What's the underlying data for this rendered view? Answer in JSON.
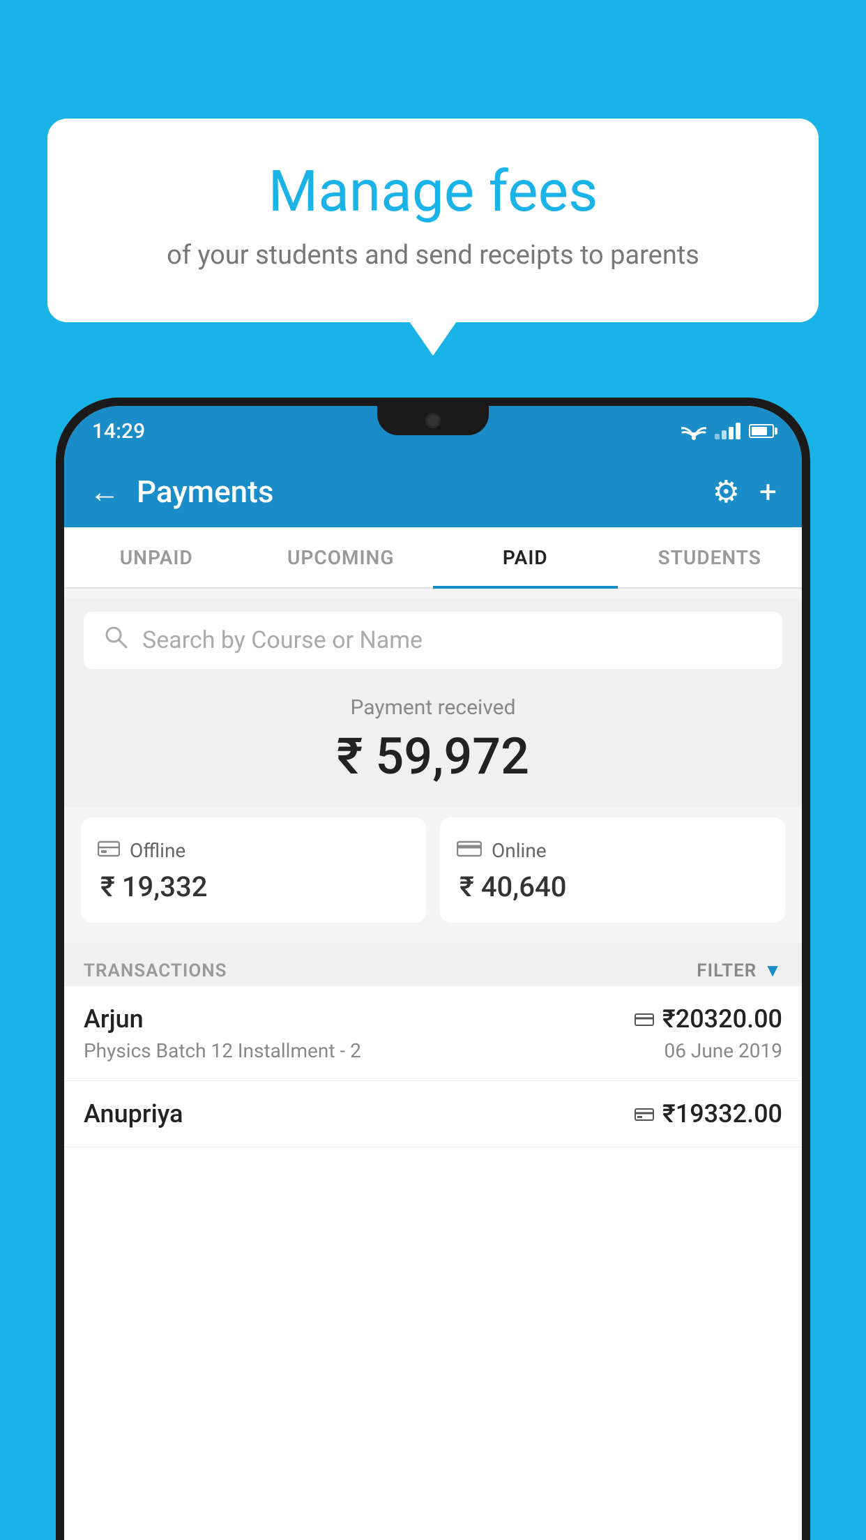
{
  "background_color": "#1ab3e8",
  "speech_bubble": {
    "title": "Manage fees",
    "subtitle": "of your students and send receipts to parents"
  },
  "status_bar": {
    "time": "14:29"
  },
  "app_bar": {
    "title": "Payments",
    "back_label": "←",
    "gear_label": "⚙",
    "plus_label": "+"
  },
  "tabs": [
    {
      "label": "UNPAID",
      "active": false
    },
    {
      "label": "UPCOMING",
      "active": false
    },
    {
      "label": "PAID",
      "active": true
    },
    {
      "label": "STUDENTS",
      "active": false
    }
  ],
  "search": {
    "placeholder": "Search by Course or Name"
  },
  "payment_summary": {
    "label": "Payment received",
    "amount": "₹ 59,972"
  },
  "payment_methods": [
    {
      "type": "offline",
      "label": "Offline",
      "amount": "₹ 19,332"
    },
    {
      "type": "online",
      "label": "Online",
      "amount": "₹ 40,640"
    }
  ],
  "transactions_section": {
    "label": "TRANSACTIONS",
    "filter_label": "FILTER"
  },
  "transactions": [
    {
      "name": "Arjun",
      "amount": "₹20320.00",
      "course": "Physics Batch 12 Installment - 2",
      "date": "06 June 2019",
      "payment_type": "online"
    },
    {
      "name": "Anupriya",
      "amount": "₹19332.00",
      "course": "",
      "date": "",
      "payment_type": "offline"
    }
  ]
}
